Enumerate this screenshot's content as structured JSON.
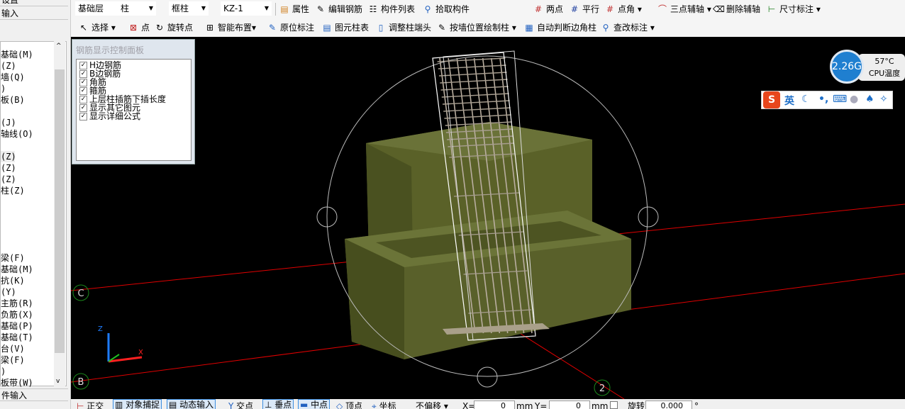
{
  "left_panel": {
    "header_top": "设置",
    "header_input": "输入",
    "items": [
      "基础(M)",
      "(Z)",
      "墙(Q)",
      ")",
      "板(B)",
      "(J)",
      "轴线(O)",
      "(Z)",
      "(Z)",
      "(Z)",
      "柱(Z)",
      "梁(F)",
      "基础(M)",
      "抗(K)",
      "(Y)",
      "主筋(R)",
      "负筋(X)",
      "基础(P)",
      "基础(T)",
      "台(V)",
      "梁(F)",
      ")",
      "板带(W)"
    ],
    "footer": "件输入"
  },
  "toolbar1": {
    "floor": "基础层",
    "type": "柱",
    "subtype": "框柱",
    "component": "KZ-1",
    "buttons": [
      "属性",
      "编辑钢筋",
      "构件列表",
      "拾取构件",
      "两点",
      "平行",
      "点角",
      "三点辅轴",
      "删除辅轴",
      "尺寸标注"
    ]
  },
  "toolbar2": {
    "buttons": [
      "选择",
      "点",
      "旋转点",
      "智能布置",
      "原位标注",
      "图元柱表",
      "调整柱端头",
      "按墙位置绘制柱",
      "自动判断边角柱",
      "查改标注"
    ]
  },
  "rebar_panel": {
    "title": "钢筋显示控制面板",
    "options": [
      {
        "label": "H边钢筋",
        "checked": true
      },
      {
        "label": "B边钢筋",
        "checked": true
      },
      {
        "label": "角筋",
        "checked": true
      },
      {
        "label": "箍筋",
        "checked": true
      },
      {
        "label": "上层柱插筋下插长度",
        "checked": true
      },
      {
        "label": "显示其它图元",
        "checked": true
      },
      {
        "label": "显示详细公式",
        "checked": true
      }
    ]
  },
  "viewport": {
    "axis_labels": [
      "C",
      "B",
      "2"
    ],
    "axis_x": "X",
    "axis_z": "Z"
  },
  "cpu_widget": {
    "memory": "2.26G",
    "temp": "57°C",
    "label": "CPU温度"
  },
  "ime": {
    "logo": "S",
    "mode": "英"
  },
  "status_bar": {
    "buttons": [
      "正交",
      "对象捕捉",
      "动态输入",
      "交点",
      "垂点",
      "中点",
      "顶点",
      "坐标"
    ],
    "offset_mode": "不偏移",
    "x_label": "X=",
    "x_value": "0",
    "y_label": "Y=",
    "y_value": "0",
    "unit": "mm",
    "rotate_label": "旋转",
    "rotate_value": "0.000",
    "degree": "°"
  },
  "colors": {
    "concrete": "#5e6530",
    "rebar": "#b9aea0",
    "axis": "#e00000",
    "axis_bubble": "#1c8a1c",
    "accent": "#3c8ee0"
  }
}
